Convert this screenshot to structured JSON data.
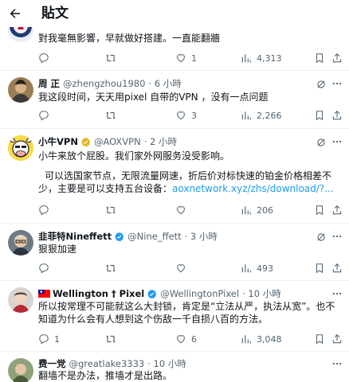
{
  "header": {
    "title": "貼文",
    "back_icon": "arrow-left-icon"
  },
  "tweets": [
    {
      "id": "t0",
      "name": "",
      "handle": "",
      "time": "",
      "text": "對我毫無影響，早就做好搭建。一直能翻牆",
      "metrics": {
        "reply": "",
        "retweet": "",
        "like": "1",
        "views": "4,313"
      }
    },
    {
      "id": "t1",
      "name": "周 正",
      "handle": "@zhengzhou1980",
      "time": "· 6 小時",
      "verified": false,
      "text": "我这段时间，天天用pixel 自带的VPN ，没有一点问题",
      "metrics": {
        "reply": "",
        "retweet": "",
        "like": "3",
        "views": "2,266"
      }
    },
    {
      "id": "t2",
      "name": "小牛VPN",
      "handle": "@AOXVPN",
      "time": "· 2 小時",
      "verified": "gold",
      "text": "小牛来放个屁股。我们家外网服务没受影响。",
      "text2": "可以选国家节点，无限流量网速，折后价对标快速的铂金价格相差不少，主要是可以支持五台设备：",
      "link": "aoxnetwork.xyz/zhs/download/?...",
      "metrics": {
        "reply": "",
        "retweet": "",
        "like": "",
        "views": "206"
      }
    },
    {
      "id": "t3",
      "name": "韭菲特Nineffett",
      "handle": "@Nine_ffett",
      "time": "· 3 小時",
      "verified": "blue",
      "text": "狠狠加速",
      "metrics": {
        "reply": "",
        "retweet": "",
        "like": "",
        "views": "493"
      }
    },
    {
      "id": "t4",
      "name": "Wellington † Pixel",
      "handle": "@WellingtonPixel",
      "time": "· 10 小時",
      "verified": "blue",
      "flag_icon": "taiwan-flag-icon",
      "text": "所以按常理不可能就这么大封锁，肯定是“立法从严，执法从宽”。也不知道为什么会有人想到这个伤敌一千自损八百的方法。",
      "metrics": {
        "reply": "1",
        "retweet": "",
        "like": "6",
        "views": "3,048"
      }
    },
    {
      "id": "t5",
      "name": "费一党",
      "handle": "@greatlake3333",
      "time": "· 10 小時",
      "verified": false,
      "text": "翻墙不是办法，推墙才是出路。",
      "metrics": {}
    }
  ],
  "colors": {
    "accent": "#1d9bf0",
    "gold": "#e2b719",
    "muted": "#536471",
    "text": "#0f1419",
    "divider": "#eff3f4"
  },
  "icons": {
    "reply": "reply-icon",
    "retweet": "retweet-icon",
    "like": "heart-icon",
    "views": "views-icon",
    "bookmark": "bookmark-icon",
    "share": "share-icon",
    "grok": "grok-icon",
    "more": "more-icon"
  }
}
